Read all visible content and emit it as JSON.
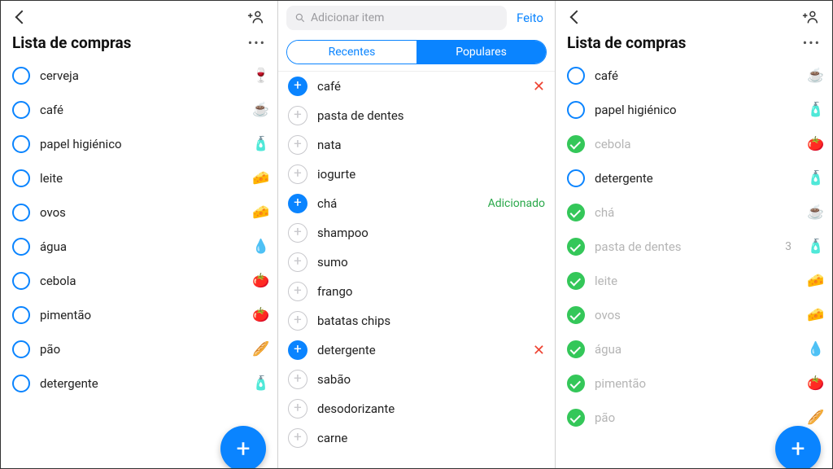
{
  "left": {
    "title": "Lista de compras",
    "items": [
      {
        "label": "cerveja",
        "emoji": "🍷"
      },
      {
        "label": "café",
        "emoji": "☕"
      },
      {
        "label": "papel higiénico",
        "emoji": "🧴"
      },
      {
        "label": "leite",
        "emoji": "🧀"
      },
      {
        "label": "ovos",
        "emoji": "🧀"
      },
      {
        "label": "água",
        "emoji": "💧"
      },
      {
        "label": "cebola",
        "emoji": "🍅"
      },
      {
        "label": "pimentão",
        "emoji": "🍅"
      },
      {
        "label": "pão",
        "emoji": "🥖"
      },
      {
        "label": "detergente",
        "emoji": "🧴"
      }
    ]
  },
  "middle": {
    "search_placeholder": "Adicionar item",
    "done_label": "Feito",
    "tabs": {
      "recent": "Recentes",
      "popular": "Populares"
    },
    "added_label": "Adicionado",
    "items": [
      {
        "label": "café",
        "action": "blue",
        "right": "x"
      },
      {
        "label": "pasta de dentes",
        "action": "gray"
      },
      {
        "label": "nata",
        "action": "gray"
      },
      {
        "label": "iogurte",
        "action": "gray"
      },
      {
        "label": "chá",
        "action": "blue",
        "right": "added"
      },
      {
        "label": "shampoo",
        "action": "gray"
      },
      {
        "label": "sumo",
        "action": "gray"
      },
      {
        "label": "frango",
        "action": "gray"
      },
      {
        "label": "batatas chips",
        "action": "gray"
      },
      {
        "label": "detergente",
        "action": "blue",
        "right": "x"
      },
      {
        "label": "sabão",
        "action": "gray"
      },
      {
        "label": "desodorizante",
        "action": "gray"
      },
      {
        "label": "carne",
        "action": "gray"
      }
    ]
  },
  "right": {
    "title": "Lista de compras",
    "items": [
      {
        "label": "café",
        "checked": false,
        "emoji": "☕"
      },
      {
        "label": "papel higiénico",
        "checked": false,
        "emoji": "🧴"
      },
      {
        "label": "cebola",
        "checked": true,
        "emoji": "🍅"
      },
      {
        "label": "detergente",
        "checked": false,
        "emoji": "🧴"
      },
      {
        "label": "chá",
        "checked": true,
        "emoji": "☕"
      },
      {
        "label": "pasta de dentes",
        "checked": true,
        "qty": "3",
        "emoji": "🧴"
      },
      {
        "label": "leite",
        "checked": true,
        "emoji": "🧀"
      },
      {
        "label": "ovos",
        "checked": true,
        "emoji": "🧀"
      },
      {
        "label": "água",
        "checked": true,
        "emoji": "💧"
      },
      {
        "label": "pimentão",
        "checked": true,
        "emoji": "🍅"
      },
      {
        "label": "pão",
        "checked": true,
        "emoji": "🥖"
      }
    ]
  }
}
